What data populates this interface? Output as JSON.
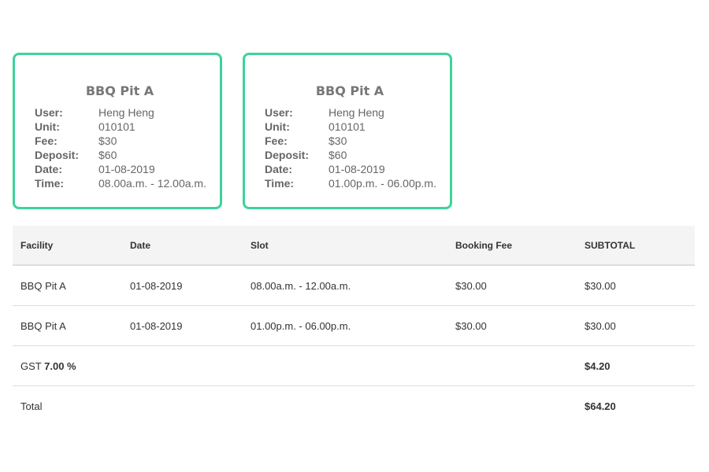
{
  "cards": [
    {
      "title": "BBQ Pit A",
      "rows": [
        {
          "key": "User:",
          "value": "Heng Heng"
        },
        {
          "key": "Unit:",
          "value": "010101"
        },
        {
          "key": "Fee:",
          "value": "$30"
        },
        {
          "key": "Deposit:",
          "value": "$60"
        },
        {
          "key": "Date:",
          "value": "01-08-2019"
        },
        {
          "key": "Time:",
          "value": "08.00a.m. - 12.00a.m."
        }
      ]
    },
    {
      "title": "BBQ Pit A",
      "rows": [
        {
          "key": "User:",
          "value": "Heng Heng"
        },
        {
          "key": "Unit:",
          "value": "010101"
        },
        {
          "key": "Fee:",
          "value": "$30"
        },
        {
          "key": "Deposit:",
          "value": "$60"
        },
        {
          "key": "Date:",
          "value": "01-08-2019"
        },
        {
          "key": "Time:",
          "value": "01.00p.m. - 06.00p.m."
        }
      ]
    }
  ],
  "table": {
    "headers": [
      "Facility",
      "Date",
      "Slot",
      "Booking Fee",
      "SUBTOTAL"
    ],
    "rows": [
      [
        "BBQ Pit A",
        "01-08-2019",
        "08.00a.m. - 12.00a.m.",
        "$30.00",
        "$30.00"
      ],
      [
        "BBQ Pit A",
        "01-08-2019",
        "01.00p.m. - 06.00p.m.",
        "$30.00",
        "$30.00"
      ]
    ],
    "gst": {
      "label": "GST",
      "rate": "7.00 %",
      "amount": "$4.20"
    },
    "total": {
      "label": "Total",
      "amount": "$64.20"
    }
  },
  "colors": {
    "card_border": "#3dd39a",
    "header_bg": "#f4f4f4"
  }
}
